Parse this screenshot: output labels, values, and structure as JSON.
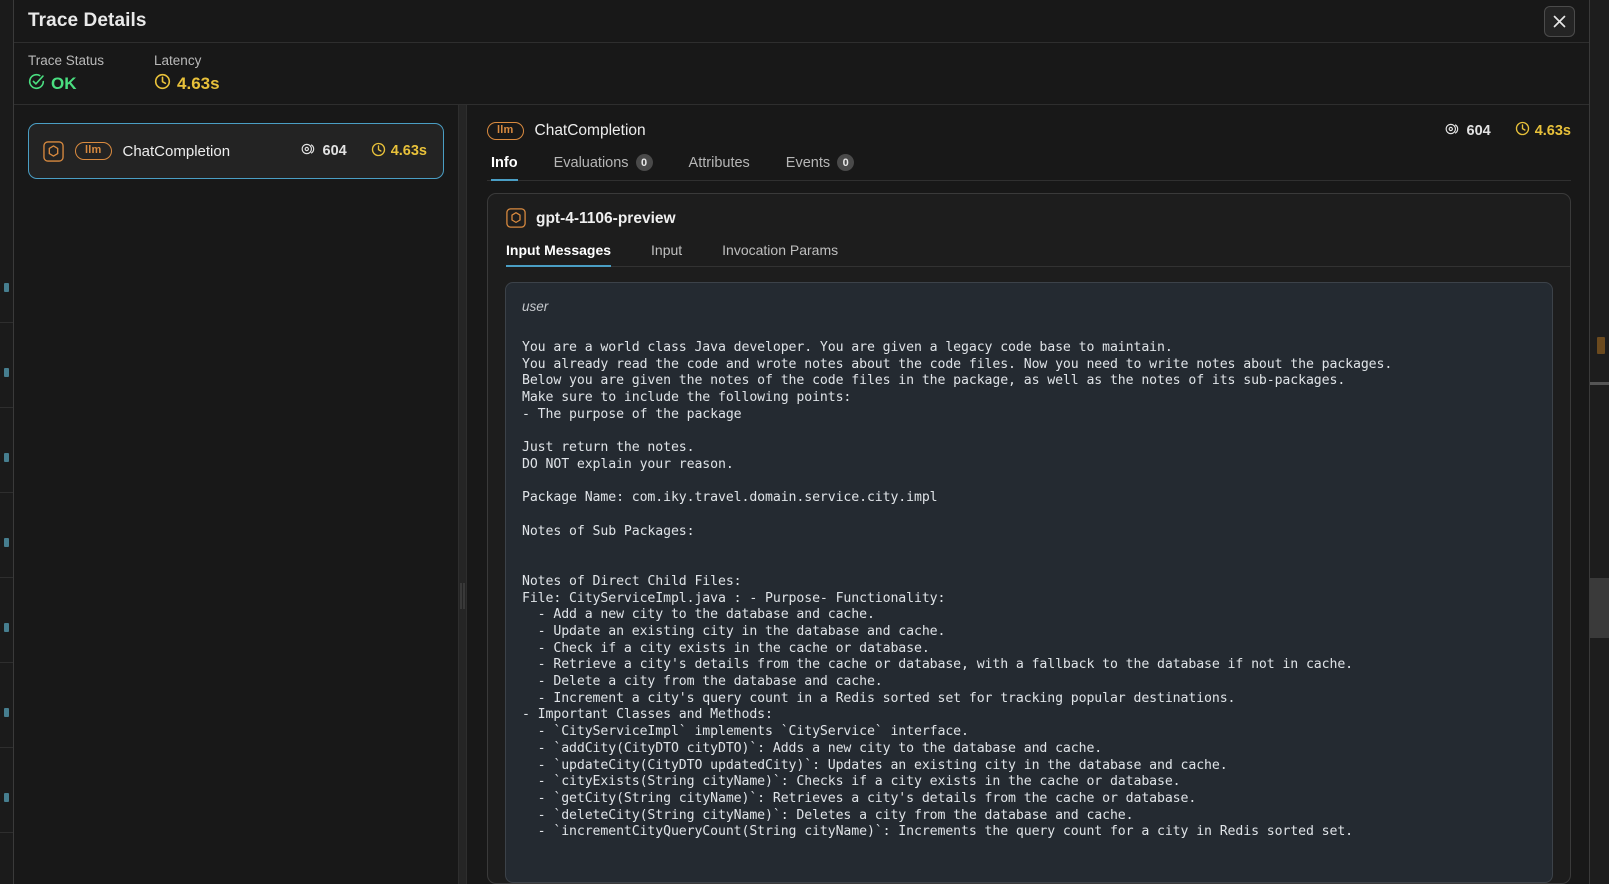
{
  "window": {
    "title": "Trace Details",
    "close_icon": "close-icon"
  },
  "summary": {
    "status": {
      "label": "Trace Status",
      "value": "OK",
      "icon": "check-circle-icon",
      "color": "#4ade80"
    },
    "latency": {
      "label": "Latency",
      "value": "4.63s",
      "icon": "clock-icon",
      "color": "#e8c13a"
    }
  },
  "span_list": {
    "items": [
      {
        "name": "ChatCompletion",
        "kind_badge": "llm",
        "kind_icon": "hexagon-icon",
        "tokens": "604",
        "tokens_icon": "tokens-icon",
        "latency": "4.63s",
        "latency_icon": "clock-icon",
        "selected": true
      }
    ]
  },
  "detail": {
    "header": {
      "kind_badge": "llm",
      "title": "ChatCompletion",
      "tokens": "604",
      "tokens_icon": "tokens-icon",
      "latency": "4.63s",
      "latency_icon": "clock-icon"
    },
    "tabs": [
      {
        "label": "Info",
        "badge": null,
        "active": true
      },
      {
        "label": "Evaluations",
        "badge": "0",
        "active": false
      },
      {
        "label": "Attributes",
        "badge": null,
        "active": false
      },
      {
        "label": "Events",
        "badge": "0",
        "active": false
      }
    ],
    "model_card": {
      "icon": "hexagon-icon",
      "model_name": "gpt-4-1106-preview",
      "subtabs": [
        {
          "label": "Input Messages",
          "active": true
        },
        {
          "label": "Input",
          "active": false
        },
        {
          "label": "Invocation Params",
          "active": false
        }
      ],
      "message": {
        "role": "user",
        "content": "You are a world class Java developer. You are given a legacy code base to maintain.\nYou already read the code and wrote notes about the code files. Now you need to write notes about the packages.\nBelow you are given the notes of the code files in the package, as well as the notes of its sub-packages.\nMake sure to include the following points:\n- The purpose of the package\n\nJust return the notes.\nDO NOT explain your reason.\n\nPackage Name: com.iky.travel.domain.service.city.impl\n\nNotes of Sub Packages:\n\n\nNotes of Direct Child Files:\nFile: CityServiceImpl.java : - Purpose- Functionality:\n  - Add a new city to the database and cache.\n  - Update an existing city in the database and cache.\n  - Check if a city exists in the cache or database.\n  - Retrieve a city's details from the cache or database, with a fallback to the database if not in cache.\n  - Delete a city from the database and cache.\n  - Increment a city's query count in a Redis sorted set for tracking popular destinations.\n- Important Classes and Methods:\n  - `CityServiceImpl` implements `CityService` interface.\n  - `addCity(CityDTO cityDTO)`: Adds a new city to the database and cache.\n  - `updateCity(CityDTO updatedCity)`: Updates an existing city in the database and cache.\n  - `cityExists(String cityName)`: Checks if a city exists in the cache or database.\n  - `getCity(String cityName)`: Retrieves a city's details from the cache or database.\n  - `deleteCity(String cityName)`: Deletes a city from the database and cache.\n  - `incrementCityQueryCount(String cityName)`: Increments the query count for a city in Redis sorted set."
      }
    }
  },
  "theme": {
    "accent_blue": "#4a9ec4",
    "accent_orange": "#d98a3f",
    "status_green": "#4ade80",
    "latency_yellow": "#e8c13a",
    "modal_bg": "#181818",
    "message_bg": "#242a31"
  }
}
